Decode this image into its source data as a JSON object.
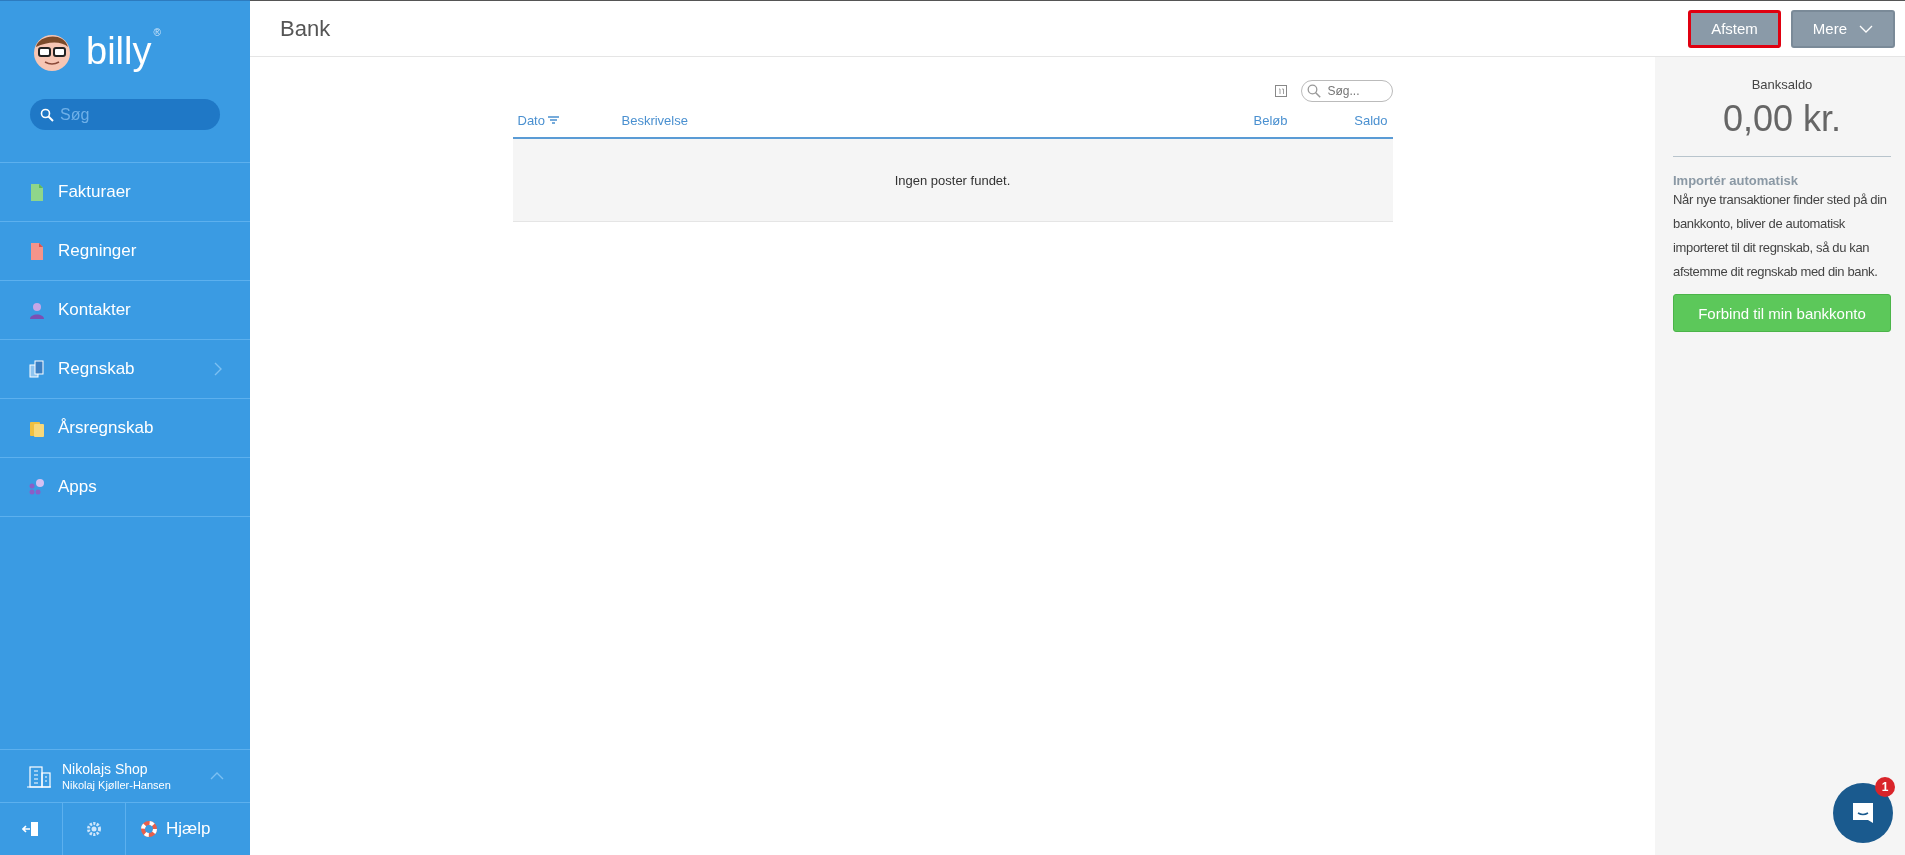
{
  "sidebar": {
    "logo": "billy",
    "logo_mark": "®",
    "search": {
      "placeholder": "Søg"
    },
    "items": [
      {
        "label": "Fakturaer",
        "kind": "invoices",
        "has_submenu": false
      },
      {
        "label": "Regninger",
        "kind": "bills",
        "has_submenu": false
      },
      {
        "label": "Kontakter",
        "kind": "contacts",
        "has_submenu": false
      },
      {
        "label": "Regnskab",
        "kind": "accounting",
        "has_submenu": true
      },
      {
        "label": "Årsregnskab",
        "kind": "annual",
        "has_submenu": false
      },
      {
        "label": "Apps",
        "kind": "apps",
        "has_submenu": false
      }
    ],
    "company": {
      "name": "Nikolajs Shop",
      "user": "Nikolaj Kjøller-Hansen"
    },
    "footer": {
      "help": "Hjælp"
    }
  },
  "header": {
    "title": "Bank",
    "buttons": [
      {
        "label": "Afstem",
        "kind": "plain",
        "highlighted": true
      },
      {
        "label": "Mere",
        "kind": "dropdown",
        "highlighted": false
      }
    ]
  },
  "table": {
    "search": {
      "placeholder": "Søg..."
    },
    "columns": [
      {
        "label": "Dato",
        "kind": "date",
        "sorted": true
      },
      {
        "label": "Beskrivelse",
        "kind": "text",
        "sorted": false
      },
      {
        "label": "Beløb",
        "kind": "amount",
        "sorted": false
      },
      {
        "label": "Saldo",
        "kind": "amount",
        "sorted": false
      }
    ],
    "empty_message": "Ingen poster fundet."
  },
  "panel": {
    "balance_label": "Banksaldo",
    "balance": "0,00 kr.",
    "import_title": "Importér automatisk",
    "import_text": "Når nye transaktioner finder sted på din bankkonto, bliver de automatisk importeret til dit regnskab, så du kan afstemme dit regnskab med din bank.",
    "connect_button": "Forbind til min bankkonto"
  },
  "chat": {
    "badge": "1"
  }
}
